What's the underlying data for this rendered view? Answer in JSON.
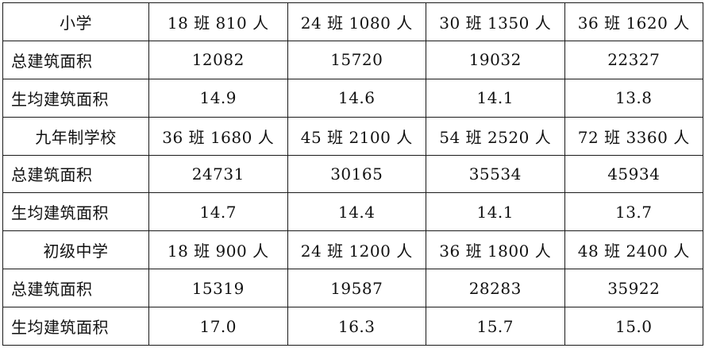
{
  "rows": [
    {
      "label": "小学",
      "cells": [
        "18 班  810 人",
        "24 班  1080 人",
        "30 班  1350 人",
        "36 班  1620 人"
      ]
    },
    {
      "label": "总建筑面积",
      "cells": [
        "12082",
        "15720",
        "19032",
        "22327"
      ]
    },
    {
      "label": "生均建筑面积",
      "cells": [
        "14.9",
        "14.6",
        "14.1",
        "13.8"
      ]
    },
    {
      "label": "九年制学校",
      "cells": [
        "36 班  1680 人",
        "45 班  2100 人",
        "54 班  2520 人",
        "72 班  3360 人"
      ]
    },
    {
      "label": "总建筑面积",
      "cells": [
        "24731",
        "30165",
        "35534",
        "45934"
      ]
    },
    {
      "label": "生均建筑面积",
      "cells": [
        "14.7",
        "14.4",
        "14.1",
        "13.7"
      ]
    },
    {
      "label": "初级中学",
      "cells": [
        "18 班  900 人",
        "24 班  1200 人",
        "36 班  1800 人",
        "48 班  2400 人"
      ]
    },
    {
      "label": "总建筑面积",
      "cells": [
        "15319",
        "19587",
        "28283",
        "35922"
      ]
    },
    {
      "label": "生均建筑面积",
      "cells": [
        "17.0",
        "16.3",
        "15.7",
        "15.0"
      ]
    }
  ]
}
